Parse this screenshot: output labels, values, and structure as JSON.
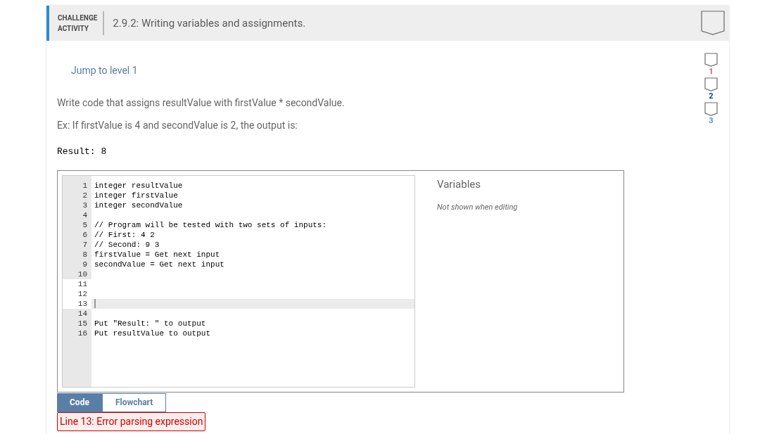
{
  "header": {
    "label_line_1": "CHALLENGE",
    "label_line_2": "ACTIVITY",
    "title": "2.9.2: Writing variables and assignments."
  },
  "jump_link": "Jump to level 1",
  "instructions": [
    "Write code that assigns resultValue with firstValue * secondValue.",
    "Ex: If firstValue is 4 and secondValue is 2, the output is:"
  ],
  "example_output": "Result: 8",
  "editor": {
    "lines": [
      {
        "number": "1",
        "code": "integer resultValue",
        "selected": false,
        "active": false
      },
      {
        "number": "2",
        "code": "integer firstValue",
        "selected": false,
        "active": false
      },
      {
        "number": "3",
        "code": "integer secondValue",
        "selected": false,
        "active": false
      },
      {
        "number": "4",
        "selected": false,
        "active": false
      },
      {
        "number": "5",
        "code": "// Program will be tested with two sets of inputs:",
        "selected": false,
        "active": false
      },
      {
        "number": "6",
        "code": "// First: 4 2",
        "selected": false,
        "active": false
      },
      {
        "number": "7",
        "code": "// Second: 9 3",
        "selected": false,
        "active": false
      },
      {
        "number": "8",
        "code": "firstValue = Get next input",
        "selected": false,
        "active": false
      },
      {
        "number": "9",
        "code": "secondValue = Get next input",
        "selected": false,
        "active": false
      },
      {
        "number": "10",
        "selected": false,
        "active": false
      },
      {
        "number": "11",
        "selected": true,
        "active": false
      },
      {
        "number": "12",
        "selected": true,
        "active": false
      },
      {
        "number": "13",
        "selected": true,
        "active": true
      },
      {
        "number": "14",
        "selected": false,
        "active": false
      },
      {
        "number": "15",
        "code": "Put \"Result: \" to output",
        "selected": false,
        "active": false
      },
      {
        "number": "16",
        "code": "Put resultValue to output",
        "selected": false,
        "active": false
      }
    ]
  },
  "variables": {
    "title": "Variables",
    "note": "Not shown when editing"
  },
  "tabs": [
    {
      "label": "Code",
      "selected": true
    },
    {
      "label": "Flowchart",
      "selected": false
    }
  ],
  "error": "Line 13: Error parsing expression",
  "levels": [
    {
      "label": "1",
      "color": "#e05555"
    },
    {
      "label": "2",
      "color": "#1a3d5c"
    },
    {
      "label": "3",
      "color": "#4a90d9"
    }
  ]
}
